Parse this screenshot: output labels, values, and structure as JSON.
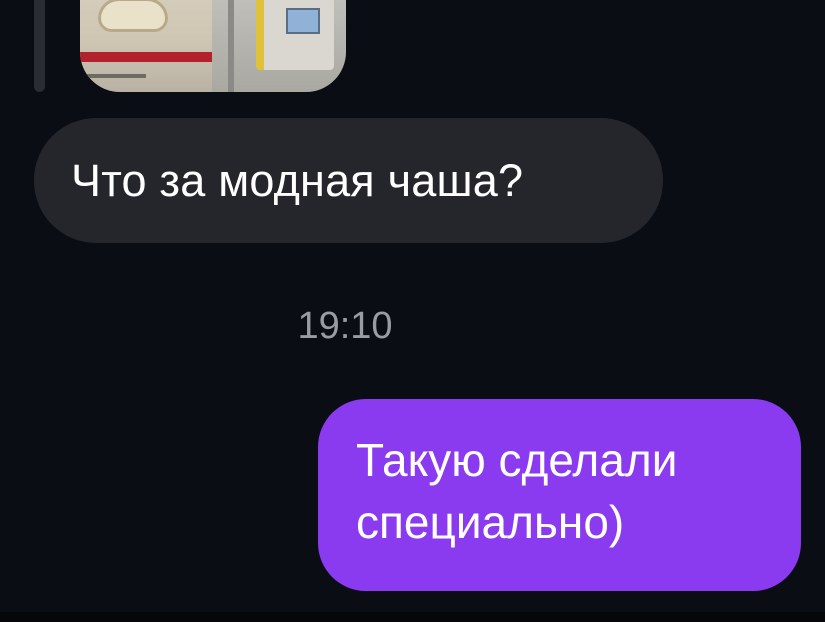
{
  "conversation": {
    "reply_thread": {
      "attachment_images": [
        "photo-left",
        "photo-right"
      ]
    },
    "incoming_message": {
      "text": "Что за модная чаша?"
    },
    "timestamp": "19:10",
    "outgoing_message": {
      "lines": [
        "Такую сделали",
        "специально)"
      ]
    }
  },
  "colors": {
    "background": "#0b0d14",
    "incoming_bubble": "#24262c",
    "outgoing_bubble": "#8a3bf0",
    "timestamp_text": "#9a9ca4"
  }
}
